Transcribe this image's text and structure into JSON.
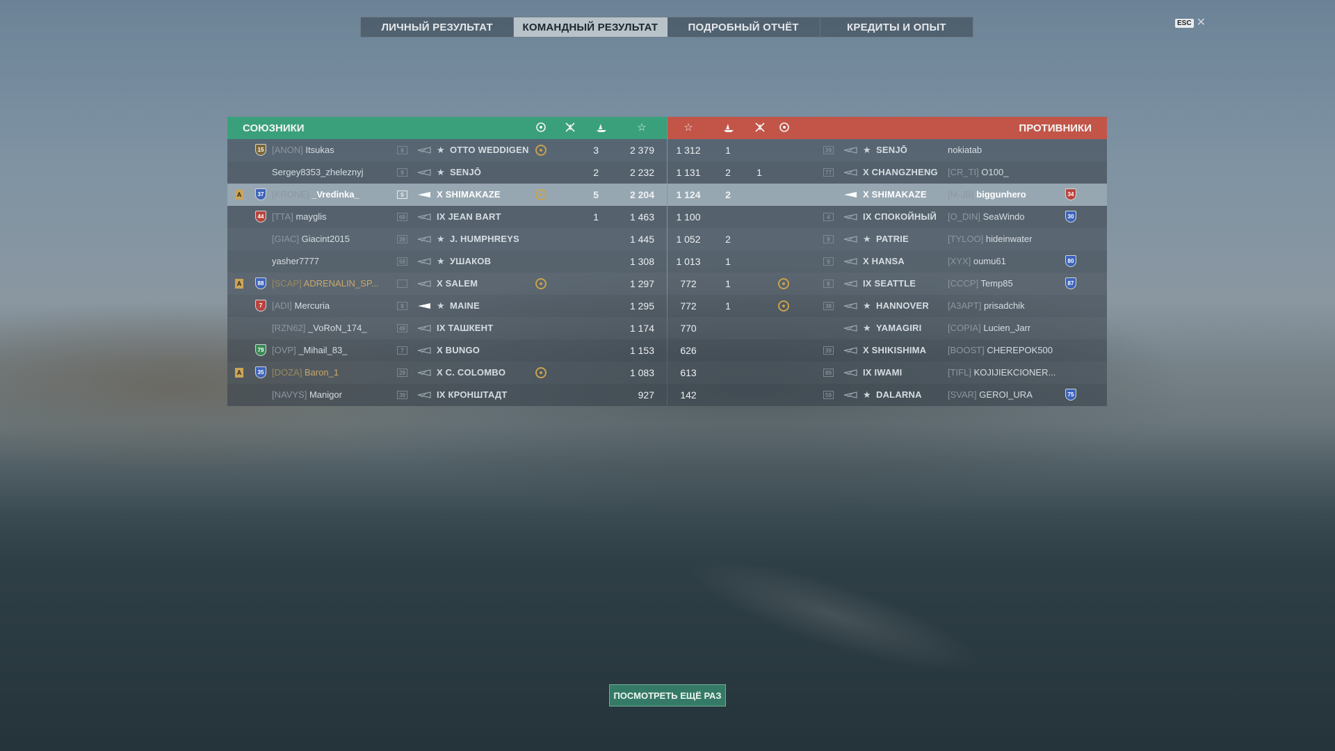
{
  "tabs": [
    {
      "label": "ЛИЧНЫЙ РЕЗУЛЬТАТ",
      "active": false
    },
    {
      "label": "КОМАНДНЫЙ РЕЗУЛЬТАТ",
      "active": true
    },
    {
      "label": "ПОДРОБНЫЙ ОТЧЁТ",
      "active": false
    },
    {
      "label": "КРЕДИТЫ И ОПЫТ",
      "active": false
    }
  ],
  "esc_label": "ESC",
  "close_glyph": "✕",
  "allies_title": "СОЮЗНИКИ",
  "enemies_title": "ПРОТИВНИКИ",
  "header_icons": {
    "medal": "laurel-medal-icon",
    "planes": "planes-destroyed-icon",
    "kills": "ships-destroyed-icon",
    "xp": "star-xp-icon"
  },
  "replay_label": "ПОСМОТРЕТЬ ЕЩЁ РАЗ",
  "rows": [
    {
      "left": {
        "division": "",
        "rank": "15",
        "rank_color": "gold",
        "clan": "[ANON]",
        "name": "Itsukas",
        "tier": "9",
        "premium": true,
        "ship": "OTTO WEDDIGEN",
        "medal": true,
        "kills": "3",
        "xp": "2 379",
        "dim": true
      },
      "right": {
        "xp": "1 312",
        "kills": "1",
        "planes": "",
        "medal": false,
        "tier": "29",
        "premium": true,
        "ship": "SENJŌ",
        "clan": "",
        "name": "nokiatab",
        "rank": "",
        "rank_color": ""
      }
    },
    {
      "left": {
        "division": "",
        "rank": "",
        "rank_color": "",
        "clan": "",
        "name": "Sergey8353_zheleznyj",
        "tier": "9",
        "premium": true,
        "ship": "SENJŌ",
        "medal": false,
        "kills": "2",
        "xp": "2 232",
        "dim": true
      },
      "right": {
        "xp": "1 131",
        "kills": "2",
        "planes": "1",
        "medal": false,
        "tier": "77",
        "premium": false,
        "ship": "X CHANGZHENG",
        "clan": "[CR_TI]",
        "name": "O100_",
        "rank": "",
        "rank_color": ""
      }
    },
    {
      "highlight": true,
      "left": {
        "division": "A",
        "rank": "37",
        "rank_color": "blue",
        "clan": "[KRONE]",
        "name": "_Vredinka_",
        "tier": "9",
        "premium": false,
        "ship": "X SHIMAKAZE",
        "medal": true,
        "kills": "5",
        "xp": "2 204",
        "dim": false
      },
      "right": {
        "xp": "1 124",
        "kills": "2",
        "planes": "",
        "medal": false,
        "tier": "",
        "premium": false,
        "ship": "X SHIMAKAZE",
        "clan": "[M-JB]",
        "name": "biggunhero",
        "rank": "34",
        "rank_color": "red"
      }
    },
    {
      "left": {
        "division": "",
        "rank": "44",
        "rank_color": "red",
        "clan": "[TTA]",
        "name": "mayglis",
        "tier": "69",
        "premium": false,
        "ship": "IX JEAN BART",
        "medal": false,
        "kills": "1",
        "xp": "1 463",
        "dim": true
      },
      "right": {
        "xp": "1 100",
        "kills": "",
        "planes": "",
        "medal": false,
        "tier": "4",
        "premium": false,
        "ship": "IX СПОКОЙНЫЙ",
        "clan": "[O_DIN]",
        "name": "SeaWindo",
        "rank": "30",
        "rank_color": "blue"
      }
    },
    {
      "left": {
        "division": "",
        "rank": "",
        "rank_color": "",
        "clan": "[GIAC]",
        "name": "Giacint2015",
        "tier": "39",
        "premium": true,
        "ship": "J. HUMPHREYS",
        "medal": false,
        "kills": "",
        "xp": "1 445",
        "dim": true
      },
      "right": {
        "xp": "1 052",
        "kills": "2",
        "planes": "",
        "medal": false,
        "tier": "9",
        "premium": true,
        "ship": "PATRIE",
        "clan": "[TYLOO]",
        "name": "hideinwater",
        "rank": "",
        "rank_color": ""
      }
    },
    {
      "left": {
        "division": "",
        "rank": "",
        "rank_color": "",
        "clan": "",
        "name": "yasher7777",
        "tier": "59",
        "premium": true,
        "ship": "УШАКОВ",
        "medal": false,
        "kills": "",
        "xp": "1 308",
        "dim": true
      },
      "right": {
        "xp": "1 013",
        "kills": "1",
        "planes": "",
        "medal": false,
        "tier": "9",
        "premium": false,
        "ship": "X HANSA",
        "clan": "[XYX]",
        "name": "oumu61",
        "rank": "80",
        "rank_color": "blue"
      }
    },
    {
      "left": {
        "division": "A",
        "rank": "88",
        "rank_color": "blue",
        "clan": "[SCAP]",
        "name": "ADRENALIN_SP...",
        "tier": "",
        "premium": false,
        "ship": "X SALEM",
        "medal": true,
        "kills": "",
        "xp": "1 297",
        "dim": true,
        "gold": true
      },
      "right": {
        "xp": "772",
        "kills": "1",
        "planes": "",
        "medal": true,
        "tier": "8",
        "premium": false,
        "ship": "IX SEATTLE",
        "clan": "[CCCP]",
        "name": "Temp85",
        "rank": "87",
        "rank_color": "blue"
      }
    },
    {
      "left": {
        "division": "",
        "rank": "7",
        "rank_color": "red",
        "clan": "[ADI]",
        "name": "Mercuria",
        "tier": "9",
        "premium": true,
        "ship": "MAINE",
        "medal": false,
        "kills": "",
        "xp": "1 295",
        "dim": false
      },
      "right": {
        "xp": "772",
        "kills": "1",
        "planes": "",
        "medal": true,
        "tier": "38",
        "premium": true,
        "ship": "HANNOVER",
        "clan": "[A3APT]",
        "name": "prisadchik",
        "rank": "",
        "rank_color": ""
      }
    },
    {
      "left": {
        "division": "",
        "rank": "",
        "rank_color": "",
        "clan": "[RZN62]",
        "name": "_VoRoN_174_",
        "tier": "49",
        "premium": false,
        "ship": "IX ТАШКЕНТ",
        "medal": false,
        "kills": "",
        "xp": "1 174",
        "dim": true
      },
      "right": {
        "xp": "770",
        "kills": "",
        "planes": "",
        "medal": false,
        "tier": "",
        "premium": true,
        "ship": "YAMAGIRI",
        "clan": "[COPIA]",
        "name": "Lucien_Jarr",
        "rank": "",
        "rank_color": ""
      }
    },
    {
      "left": {
        "division": "",
        "rank": "79",
        "rank_color": "green",
        "clan": "[OVP]",
        "name": "_Mihail_83_",
        "tier": "7",
        "premium": false,
        "ship": "X BUNGO",
        "medal": false,
        "kills": "",
        "xp": "1 153",
        "dim": true
      },
      "right": {
        "xp": "626",
        "kills": "",
        "planes": "",
        "medal": false,
        "tier": "39",
        "premium": false,
        "ship": "X SHIKISHIMA",
        "clan": "[BOOST]",
        "name": "CHEREPOK500",
        "rank": "",
        "rank_color": ""
      }
    },
    {
      "left": {
        "division": "A",
        "rank": "35",
        "rank_color": "blue",
        "clan": "[DOZA]",
        "name": "Baron_1",
        "tier": "29",
        "premium": false,
        "ship": "X C. COLOMBO",
        "medal": true,
        "kills": "",
        "xp": "1 083",
        "dim": true,
        "gold": true
      },
      "right": {
        "xp": "613",
        "kills": "",
        "planes": "",
        "medal": false,
        "tier": "89",
        "premium": false,
        "ship": "IX IWAMI",
        "clan": "[TIFL]",
        "name": "KOJIJIEKCIONER...",
        "rank": "",
        "rank_color": ""
      }
    },
    {
      "left": {
        "division": "",
        "rank": "",
        "rank_color": "",
        "clan": "[NAVYS]",
        "name": "Manigor",
        "tier": "39",
        "premium": false,
        "ship": "IX КРОНШТАДТ",
        "medal": false,
        "kills": "",
        "xp": "927",
        "dim": true
      },
      "right": {
        "xp": "142",
        "kills": "",
        "planes": "",
        "medal": false,
        "tier": "59",
        "premium": true,
        "ship": "DALARNA",
        "clan": "[SVAR]",
        "name": "GEROI_URA",
        "rank": "75",
        "rank_color": "blue"
      }
    }
  ]
}
